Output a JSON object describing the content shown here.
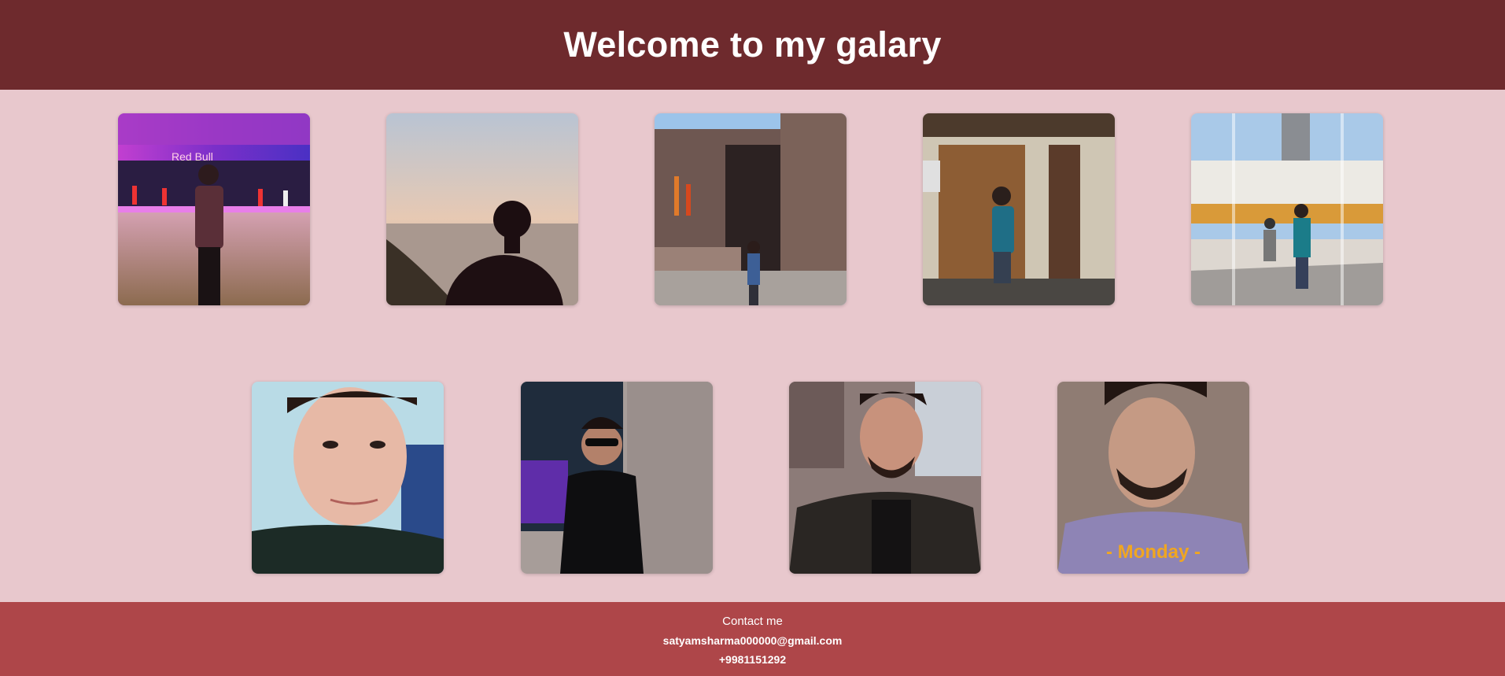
{
  "header": {
    "title": "Welcome to my galary"
  },
  "gallery": {
    "photos": [
      {
        "subject": "photo-party-neon",
        "sign_text": "Red Bull"
      },
      {
        "subject": "photo-sunset-lake"
      },
      {
        "subject": "photo-temple"
      },
      {
        "subject": "photo-mirror-selfie"
      },
      {
        "subject": "photo-monument-crowd"
      },
      {
        "subject": "photo-portrait-smile"
      },
      {
        "subject": "photo-sunglasses-portrait"
      },
      {
        "subject": "photo-jacket-portrait"
      },
      {
        "subject": "photo-monday-tshirt",
        "shirt_text": "- Monday -"
      }
    ]
  },
  "footer": {
    "contact_title": "Contact me",
    "email": "satyamsharma000000@gmail.com",
    "phone": "+9981151292"
  },
  "colors": {
    "header_bg": "#6e2a2d",
    "page_bg": "#e8c8cd",
    "footer_bg": "#ae4649",
    "text_light": "#ffffff"
  }
}
